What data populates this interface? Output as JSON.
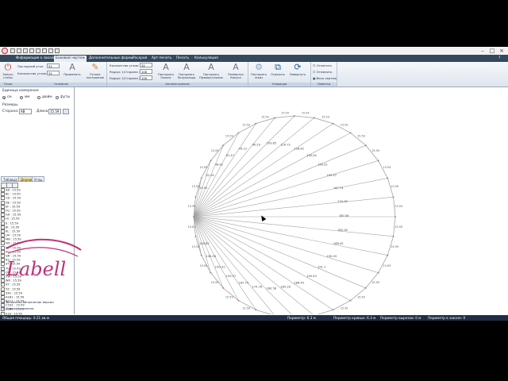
{
  "tabs": [
    {
      "label": "Информация о заказе",
      "active": false
    },
    {
      "label": "Боковой чертеж",
      "active": true
    },
    {
      "label": "Дополнительные формы",
      "active": false
    },
    {
      "label": "Раскрой",
      "active": false
    },
    {
      "label": "Арт-печать",
      "active": false
    },
    {
      "label": "Печать",
      "active": false
    },
    {
      "label": "Калькуляция",
      "active": false
    }
  ],
  "ribbon": {
    "wall_label": "Запуск\nстены",
    "last_angle_label": "Последний угол:",
    "last_angle_value": "51",
    "angle_count_label": "Количество углов:",
    "angle_count_value": "32",
    "apply_label": "Применить",
    "manual_label": "Ручное\nпостроение",
    "group_main": "Основное",
    "group_points": "Точки",
    "angle_qty_label": "Количество углов:",
    "angle_qty_value": "32",
    "radius1_label": "Радиус 1/Сторона 1:",
    "radius1_value": "100",
    "radius2_label": "Радиус 2/Сторона 2:",
    "radius2_value": "100",
    "build_ellipse": "Построить\nЭллипс",
    "build_semicircle": "Построить\nПолукольцо",
    "build_rect": "Построить\nПрямоугольник",
    "build_cone": "Развертка\nКонуса",
    "group_auto": "Автопостроение",
    "build_sketch": "Построить\nэскиз",
    "mirror_label": "Отразить",
    "rotate_label": "Повернуть",
    "group_other": "Операции",
    "mark_label": "Отметить",
    "unmark_label": "Отменить",
    "whole_label": "Весь чертеж",
    "group_marks": "Пометки"
  },
  "left_panel": {
    "units_title": "Единица измерения",
    "units": [
      {
        "label": "см",
        "selected": true
      },
      {
        "label": "мм",
        "selected": false
      },
      {
        "label": "дюйм",
        "selected": false
      },
      {
        "label": "футы",
        "selected": false
      }
    ],
    "walls_title": "Размеры",
    "side_label": "Сторона:",
    "side_value": "AB",
    "length_label": "Длина:",
    "length_value": "15.59",
    "tabs": [
      {
        "label": "Таблица",
        "active": false
      },
      {
        "label": "Дерево",
        "active": true
      },
      {
        "label": "Углы",
        "active": false
      }
    ],
    "list": [
      "AB : 15.59",
      "BC : 15.59",
      "CD : 15.59",
      "DE : 15.59",
      "EF : 15.59",
      "FG : 15.59",
      "GH : 15.59",
      "HI : 15.59",
      "IJ : 15.59",
      "JK : 15.59",
      "KL : 15.59",
      "LM : 15.59",
      "MN : 15.59",
      "NO : 15.59",
      "OP : 15.59",
      "PQ : 15.59",
      "QR : 15.59",
      "RS : 15.59",
      "ST : 15.59",
      "TU : 15.59",
      "UV : 15.59",
      "VW : 15.59",
      "WX : 15.59",
      "XY : 15.59",
      "YZ : 15.59",
      "ZA1 : 15.59",
      "A1B1 : 15.59",
      "B1C1 : 15.59",
      "C1D1 : 15.59",
      "D1E1 : 15.59",
      "E1A : 15.59",
      "A : 15.61"
    ],
    "opt1": "Включено обновление версии",
    "opt2": "Сдвинуть панели"
  },
  "status": {
    "total": "Общая площадь: 0.21 кв.м",
    "perimeter": "Периметр: 6.3 м",
    "curve_perimeter": "Периметр кривых: 6.3 м",
    "cutout_perimeter": "Периметр вырезов: 0 м",
    "order_perimeter": "Периметр в заказе: 0"
  },
  "logo_text": "Labell",
  "drawing": {
    "line_color": "#a3a3a3",
    "accent_color": "#c0607a",
    "chord_labels": [
      "15.59",
      "31.09",
      "46.42",
      "61.47",
      "76.13",
      "90.29",
      "103.85",
      "116.72",
      "128.82",
      "140.04",
      "150.31",
      "159.57",
      "167.74",
      "174.76",
      "180.58",
      "185.16",
      "188.45",
      "190.43",
      "191.1",
      "190.43",
      "188.45",
      "185.16",
      "180.58",
      "174.76",
      "167.74",
      "159.57",
      "150.31",
      "140.04",
      "128.82"
    ]
  }
}
